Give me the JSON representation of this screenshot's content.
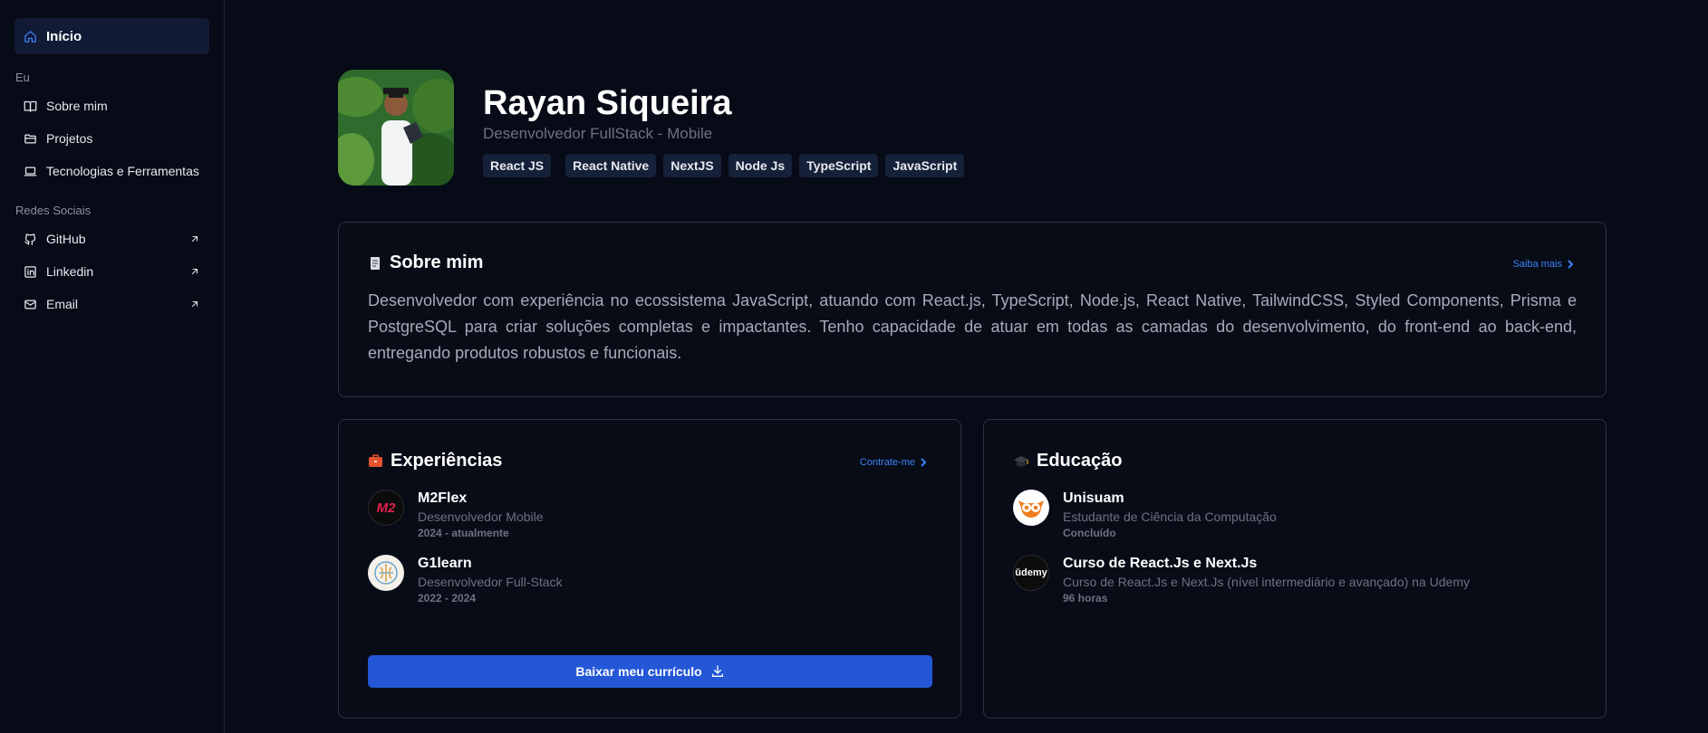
{
  "sidebar": {
    "home_label": "Início",
    "section_me": "Eu",
    "me_items": [
      {
        "label": "Sobre mim",
        "icon": "book-open-icon"
      },
      {
        "label": "Projetos",
        "icon": "folder-icon"
      },
      {
        "label": "Tecnologias e Ferramentas",
        "icon": "laptop-icon"
      }
    ],
    "section_social": "Redes Sociais",
    "social_items": [
      {
        "label": "GitHub",
        "icon": "github-icon"
      },
      {
        "label": "Linkedin",
        "icon": "linkedin-icon"
      },
      {
        "label": "Email",
        "icon": "mail-icon"
      }
    ]
  },
  "profile": {
    "name": "Rayan Siqueira",
    "role": "Desenvolvedor FullStack - Mobile",
    "tags": [
      "React JS",
      "React Native",
      "NextJS",
      "Node Js",
      "TypeScript",
      "JavaScript"
    ]
  },
  "about": {
    "title": "Sobre mim",
    "link": "Saiba mais",
    "text": "Desenvolvedor com experiência no ecossistema JavaScript, atuando com React.js, TypeScript, Node.js, React Native, TailwindCSS, Styled Components, Prisma e PostgreSQL para criar soluções completas e impactantes. Tenho capacidade de atuar em todas as camadas do desenvolvimento, do front-end ao back-end, entregando produtos robustos e funcionais."
  },
  "experience": {
    "title": "Experiências",
    "link": "Contrate-me",
    "items": [
      {
        "name": "M2Flex",
        "role": "Desenvolvedor Mobile",
        "date": "2024 - atualmente"
      },
      {
        "name": "G1learn",
        "role": "Desenvolvedor Full-Stack",
        "date": "2022 - 2024"
      }
    ],
    "download_label": "Baixar meu currículo",
    "m2_logo_text": "M2"
  },
  "education": {
    "title": "Educação",
    "items": [
      {
        "name": "Unisuam",
        "role": "Estudante de Ciência da Computação",
        "date": "Concluído"
      },
      {
        "name": "Curso de React.Js e Next.Js",
        "role": "Curso de React.Js e Next.Js (nível intermediário e avançado) na Udemy",
        "date": "96 horas"
      }
    ],
    "udemy_logo_text": "ūdemy"
  },
  "colors": {
    "background": "#070b17",
    "accent": "#3b82f6",
    "button": "#2357d6",
    "tag_bg": "#152039"
  }
}
